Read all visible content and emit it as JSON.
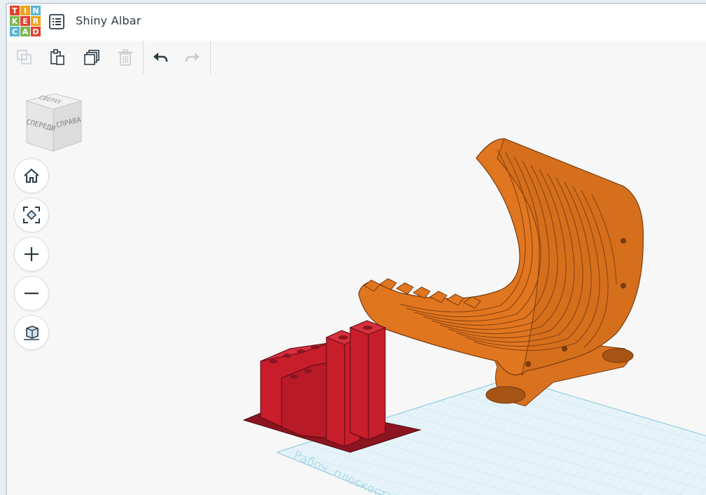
{
  "app": {
    "logo_letters": [
      "T",
      "I",
      "N",
      "K",
      "E",
      "R",
      "C",
      "A",
      "D"
    ],
    "logo_colors": [
      "#e2412e",
      "#f0a31c",
      "#5ab4d6",
      "#7ab64f",
      "#e2412e",
      "#f0a31c",
      "#5ab4d6",
      "#7ab64f",
      "#e2412e"
    ]
  },
  "header": {
    "title": "Shiny Albar"
  },
  "toolbar": {
    "buttons": [
      "copy-icon",
      "paste-icon",
      "duplicate-icon",
      "trash-icon",
      "undo-icon",
      "redo-icon"
    ]
  },
  "viewcube": {
    "front_label": "СПЕРЕДИ",
    "right_label": "СПРАВА",
    "top_label": "СВЕРХУ"
  },
  "nav_controls": [
    "home-icon",
    "fit-view-icon",
    "zoom-in-icon",
    "zoom-out-icon",
    "ortho-view-icon"
  ],
  "workplane": {
    "label": "Рабоч. плоскость"
  },
  "colors": {
    "orange_shape": "#e0761f",
    "red_shape": "#c81e2c",
    "grid": "#cfe9f2"
  }
}
